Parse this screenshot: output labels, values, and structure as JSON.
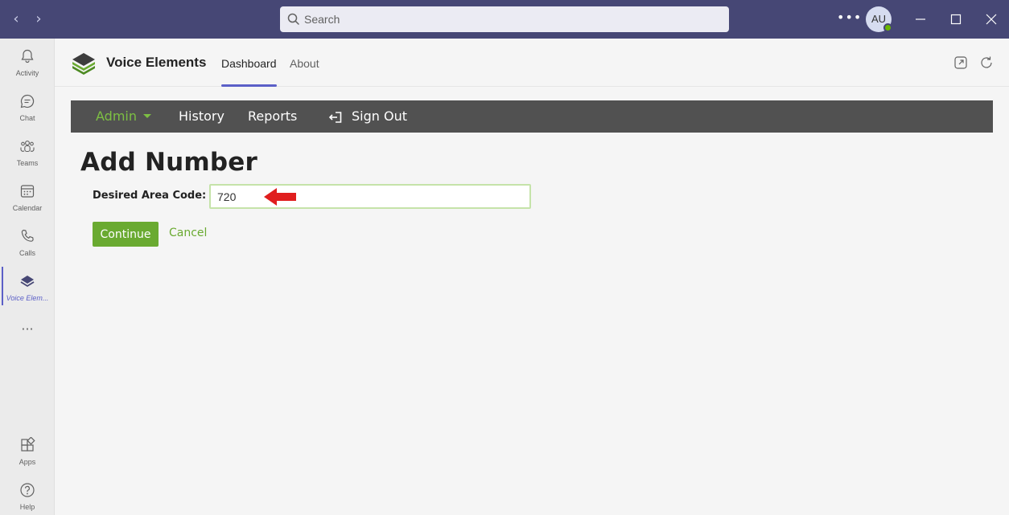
{
  "titlebar": {
    "search_placeholder": "Search",
    "avatar_initials": "AU",
    "colors": {
      "bar": "#464775",
      "presence": "#6bb700"
    }
  },
  "rail": {
    "items": [
      {
        "label": "Activity",
        "icon": "bell-icon"
      },
      {
        "label": "Chat",
        "icon": "chat-icon"
      },
      {
        "label": "Teams",
        "icon": "teams-icon"
      },
      {
        "label": "Calendar",
        "icon": "calendar-icon"
      },
      {
        "label": "Calls",
        "icon": "phone-icon"
      },
      {
        "label": "Voice Elem...",
        "icon": "voice-elements-icon",
        "active": true
      }
    ],
    "more": "···",
    "bottom": [
      {
        "label": "Apps",
        "icon": "apps-icon"
      },
      {
        "label": "Help",
        "icon": "help-icon"
      }
    ]
  },
  "app": {
    "title": "Voice Elements",
    "tabs": [
      "Dashboard",
      "About"
    ],
    "active_tab": "Dashboard"
  },
  "navbar": {
    "admin": "Admin",
    "history": "History",
    "reports": "Reports",
    "signout": "Sign Out",
    "colors": {
      "background": "#515151",
      "accent": "#7dc043"
    }
  },
  "form": {
    "title": "Add Number",
    "area_code_label": "Desired Area Code:",
    "area_code_value": "720",
    "continue_label": "Continue",
    "cancel_label": "Cancel",
    "colors": {
      "button": "#6aaa31",
      "annotation_arrow": "#e01e1e"
    }
  }
}
